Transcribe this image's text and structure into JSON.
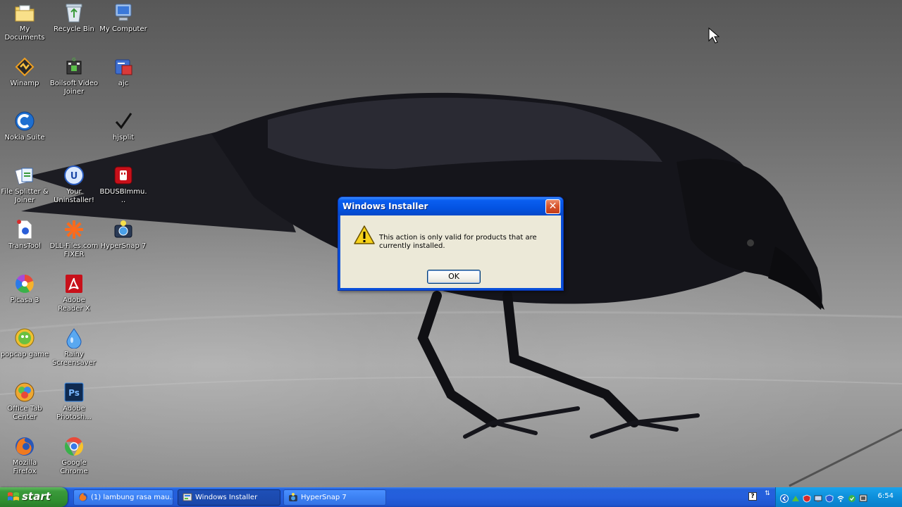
{
  "desktop": {
    "icons": [
      {
        "label": "My Documents",
        "icon": "folder-documents-icon"
      },
      {
        "label": "Recycle Bin",
        "icon": "recycle-bin-icon"
      },
      {
        "label": "My Computer",
        "icon": "computer-icon"
      },
      {
        "label": "Winamp",
        "icon": "winamp-icon"
      },
      {
        "label": "Boilsoft Video Joiner",
        "icon": "video-joiner-icon"
      },
      {
        "label": "ajc",
        "icon": "ajc-icon"
      },
      {
        "label": "Nokia Suite",
        "icon": "nokia-suite-icon"
      },
      {
        "label": "hjsplit",
        "icon": "hjsplit-icon"
      },
      {
        "label": "File Splitter & Joiner",
        "icon": "file-splitter-icon"
      },
      {
        "label": "Your Uninstaller!",
        "icon": "uninstaller-icon"
      },
      {
        "label": "BDUSBImmu...",
        "icon": "usb-immunizer-icon"
      },
      {
        "label": "TransTool",
        "icon": "transtool-icon"
      },
      {
        "label": "DLL-Files.com FIXER",
        "icon": "dll-fixer-icon"
      },
      {
        "label": "HyperSnap 7",
        "icon": "hypersnap-icon"
      },
      {
        "label": "Picasa 3",
        "icon": "picasa-icon"
      },
      {
        "label": "Adobe Reader X",
        "icon": "adobe-reader-icon"
      },
      {
        "label": "popcap game",
        "icon": "popcap-icon"
      },
      {
        "label": "Rainy Screensaver",
        "icon": "raindrop-icon"
      },
      {
        "label": "Office Tab Center",
        "icon": "office-tab-icon"
      },
      {
        "label": "Adobe Photosh...",
        "icon": "photoshop-icon"
      },
      {
        "label": "Mozilla Firefox",
        "icon": "firefox-icon"
      },
      {
        "label": "Google Chrome",
        "icon": "chrome-icon"
      }
    ]
  },
  "dialog": {
    "title": "Windows Installer",
    "close_label": "✕",
    "message": "This action is only valid for products that are currently installed.",
    "ok_label": "OK"
  },
  "taskbar": {
    "start_label": "start",
    "tasks": [
      {
        "label": "(1) lambung rasa mau...",
        "icon": "firefox-icon",
        "active": false
      },
      {
        "label": "Windows Installer",
        "icon": "installer-icon",
        "active": true
      },
      {
        "label": "HyperSnap 7",
        "icon": "hypersnap-icon",
        "active": false
      }
    ],
    "clock": "6:54"
  },
  "colors": {
    "xp_blue": "#245edc",
    "start_green": "#3b9a3b",
    "tray_blue": "#0d8fdb",
    "dialog_face": "#ece9d8"
  }
}
